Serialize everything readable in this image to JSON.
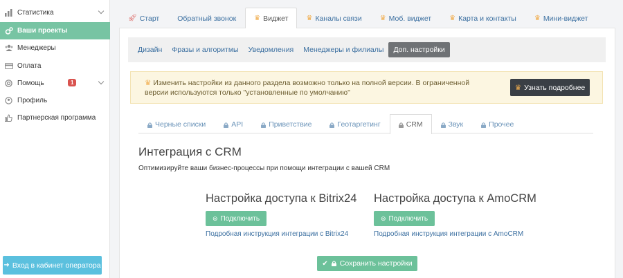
{
  "sidebar": {
    "items": [
      {
        "label": "Статистика",
        "icon": "chart-icon"
      },
      {
        "label": "Ваши проекты",
        "icon": "gears-icon"
      },
      {
        "label": "Менеджеры",
        "icon": "users-icon"
      },
      {
        "label": "Оплата",
        "icon": "card-icon"
      },
      {
        "label": "Помощь",
        "icon": "lifebuoy-icon",
        "badge": "1"
      },
      {
        "label": "Профиль",
        "icon": "user-icon"
      },
      {
        "label": "Партнерская программа",
        "icon": "thumbs-up-icon"
      }
    ],
    "operator_button": "Вход в кабинет оператора"
  },
  "top_tabs": [
    "Старт",
    "Обратный звонок",
    "Виджет",
    "Каналы связи",
    "Моб. виджет",
    "Карта и контакты",
    "Мини-виджет"
  ],
  "subnav": [
    "Дизайн",
    "Фразы и алгоритмы",
    "Уведомления",
    "Менеджеры и филиалы",
    "Доп. настройки"
  ],
  "warning": {
    "text": "Изменить настройки из данного раздела возможно только на полной версии. В ограниченной версии используются только \"установленные по умолчанию\"",
    "button": "Узнать подробнее"
  },
  "inner_tabs": [
    "Черные списки",
    "API",
    "Приветствие",
    "Геотаргетинг",
    "CRM",
    "Звук",
    "Прочее"
  ],
  "main": {
    "title": "Интеграция с CRM",
    "description": "Оптимизируйте ваши бизнес-процессы при помощи интеграции с вашей CRM"
  },
  "crm": [
    {
      "title": "Настройка доступа к Bitrix24",
      "button": "Подключить",
      "link": "Подробная инструкция интеграции с Bitrix24"
    },
    {
      "title": "Настройка доступа к AmoCRM",
      "button": "Подключить",
      "link": "Подробная инструкция интеграции с AmoCRM"
    }
  ],
  "save_button": "Сохранить настройки",
  "colors": {
    "accent_green": "#77c4a3",
    "link_blue": "#3b6fa0",
    "crown": "#f0ad4e",
    "badge_red": "#d9534f"
  }
}
